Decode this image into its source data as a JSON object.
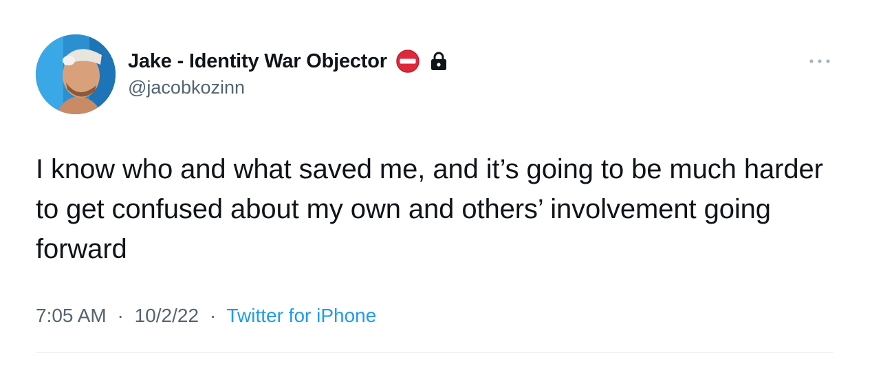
{
  "author": {
    "display_name": "Jake - Identity War Objector",
    "handle": "@jacobkozinn",
    "badges": [
      "no-entry-icon",
      "lock-icon"
    ]
  },
  "more_menu": {
    "icon": "ellipsis-icon"
  },
  "tweet": {
    "text": "I know who and what saved me, and it’s going to be much harder to get confused about my own and others’ involvement going forward"
  },
  "meta": {
    "time": "7:05 AM",
    "separator": "·",
    "date": "10/2/22",
    "source": "Twitter for iPhone"
  },
  "colors": {
    "text_primary": "#0f1419",
    "text_secondary": "#536471",
    "link": "#1d9bf0",
    "no_entry_red": "#e0283c",
    "divider": "#eff3f4"
  }
}
